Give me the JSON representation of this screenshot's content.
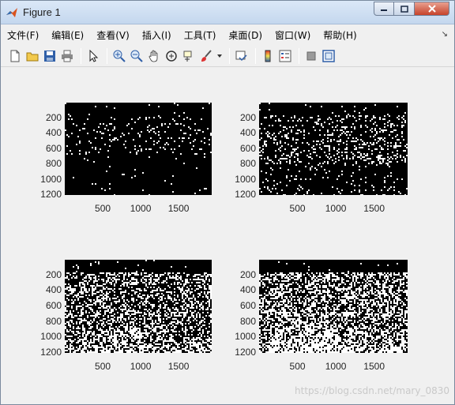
{
  "window": {
    "title": "Figure 1"
  },
  "menu": [
    {
      "label": "文件(F)"
    },
    {
      "label": "编辑(E)"
    },
    {
      "label": "查看(V)"
    },
    {
      "label": "插入(I)"
    },
    {
      "label": "工具(T)"
    },
    {
      "label": "桌面(D)"
    },
    {
      "label": "窗口(W)"
    },
    {
      "label": "帮助(H)"
    }
  ],
  "toolbar": {
    "icons": [
      "new-figure-icon",
      "open-file-icon",
      "save-icon",
      "print-icon",
      "pointer-icon",
      "zoom-in-icon",
      "zoom-out-icon",
      "pan-icon",
      "rotate-3d-icon",
      "data-cursor-icon",
      "brush-icon",
      "link-plot-icon",
      "colorbar-icon",
      "legend-icon",
      "hide-plot-tools-icon",
      "show-plot-tools-icon"
    ]
  },
  "colors": {
    "image_bg": "#000000",
    "image_fg": "#ffffff",
    "window_bg": "#f0f0f0"
  },
  "chart_data": [
    {
      "type": "heatmap",
      "subplot": 1,
      "yticks": [
        "200",
        "400",
        "600",
        "800",
        "1000",
        "1200"
      ],
      "xticks": [
        "500",
        "1000",
        "1500"
      ],
      "white_density": 0.12
    },
    {
      "type": "heatmap",
      "subplot": 2,
      "yticks": [
        "200",
        "400",
        "600",
        "800",
        "1000",
        "1200"
      ],
      "xticks": [
        "500",
        "1000",
        "1500"
      ],
      "white_density": 0.25
    },
    {
      "type": "heatmap",
      "subplot": 3,
      "yticks": [
        "200",
        "400",
        "600",
        "800",
        "1000",
        "1200"
      ],
      "xticks": [
        "500",
        "1000",
        "1500"
      ],
      "white_density": 0.5
    },
    {
      "type": "heatmap",
      "subplot": 4,
      "yticks": [
        "200",
        "400",
        "600",
        "800",
        "1000",
        "1200"
      ],
      "xticks": [
        "500",
        "1000",
        "1500"
      ],
      "white_density": 0.62
    }
  ],
  "watermark": "https://blog.csdn.net/mary_0830"
}
